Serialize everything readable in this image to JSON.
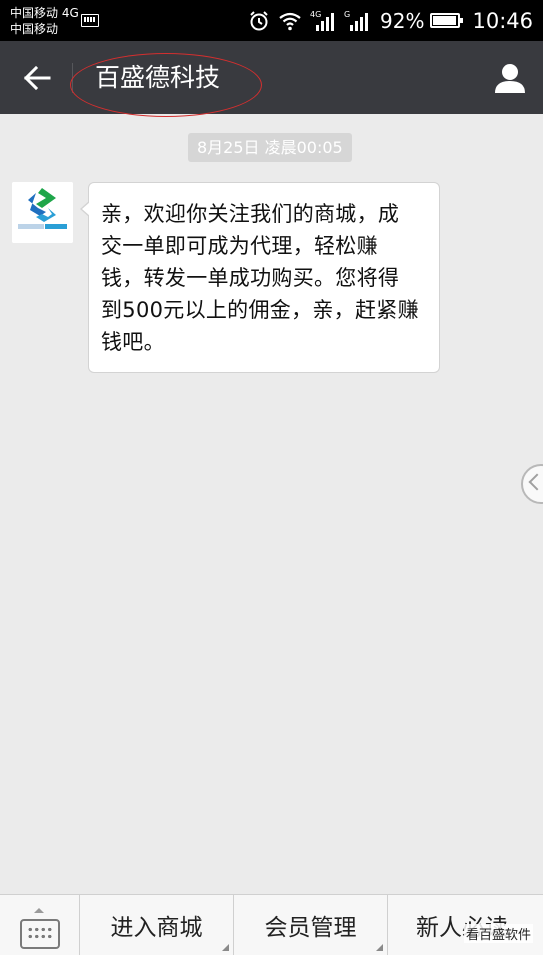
{
  "status_bar": {
    "carrier_line1": "中国移动 4G",
    "carrier_line2": "中国移动",
    "icons": [
      "keyboard-icon",
      "alarm-icon",
      "wifi-icon",
      "signal-4g-icon",
      "signal-g-icon"
    ],
    "signal_4g_label": "4G",
    "signal_g_label": "G",
    "battery_percent_text": "92%",
    "battery_level": 0.92,
    "time": "10:46"
  },
  "header": {
    "title": "百盛德科技",
    "back_icon": "arrow-left-icon",
    "profile_icon": "person-icon",
    "background": "#393a3f",
    "annotation_color": "#d32f2f"
  },
  "chat": {
    "timestamp": "8月25日 凌晨00:05",
    "messages": [
      {
        "sender": "bot",
        "avatar_icon": "company-logo-icon",
        "text": "亲，欢迎你关注我们的商城，成交一单即可成为代理，轻松赚钱，转发一单成功购买。您将得到500元以上的佣金，亲，赶紧赚钱吧。"
      }
    ],
    "background": "#ebebeb"
  },
  "bottom_menu": {
    "keyboard_icon": "keyboard-icon",
    "items": [
      {
        "label": "进入商城"
      },
      {
        "label": "会员管理"
      },
      {
        "label": "新人必读"
      }
    ],
    "watermark": "看百盛软件"
  }
}
